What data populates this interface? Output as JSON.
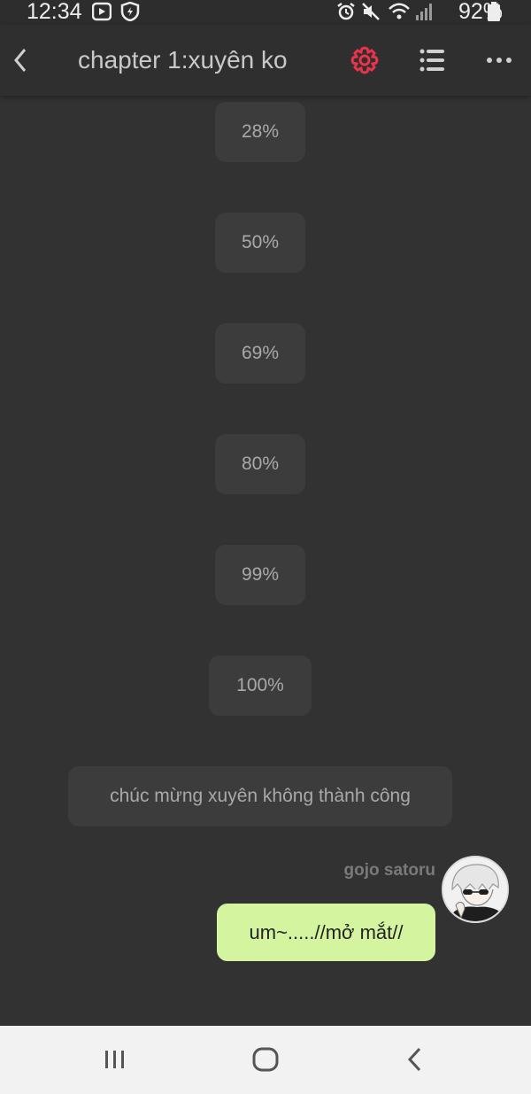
{
  "status_bar": {
    "time": "12:34",
    "battery": "92%",
    "icons": [
      "video-icon",
      "shield-icon",
      "alarm-icon",
      "mute-icon",
      "wifi-icon",
      "signal-icon",
      "battery-icon"
    ]
  },
  "app_bar": {
    "title": "chapter 1:xuyên ko",
    "icons": [
      "back-arrow-icon",
      "settings-gear-icon",
      "list-icon",
      "more-dots-icon"
    ],
    "accent_color": "#e8334a"
  },
  "messages": {
    "progress": [
      "28%",
      "50%",
      "69%",
      "80%",
      "99%",
      "100%"
    ],
    "system_text": "chúc mừng xuyên không thành công",
    "character_name": "gojo satoru",
    "character_message": "um~.....//mở mắt//"
  },
  "nav_bar": {
    "icons": [
      "recent-apps-icon",
      "home-icon",
      "back-icon"
    ]
  },
  "colors": {
    "background": "#323232",
    "bubble": "#3c3c3c",
    "user_bubble": "#d4f4a0"
  }
}
